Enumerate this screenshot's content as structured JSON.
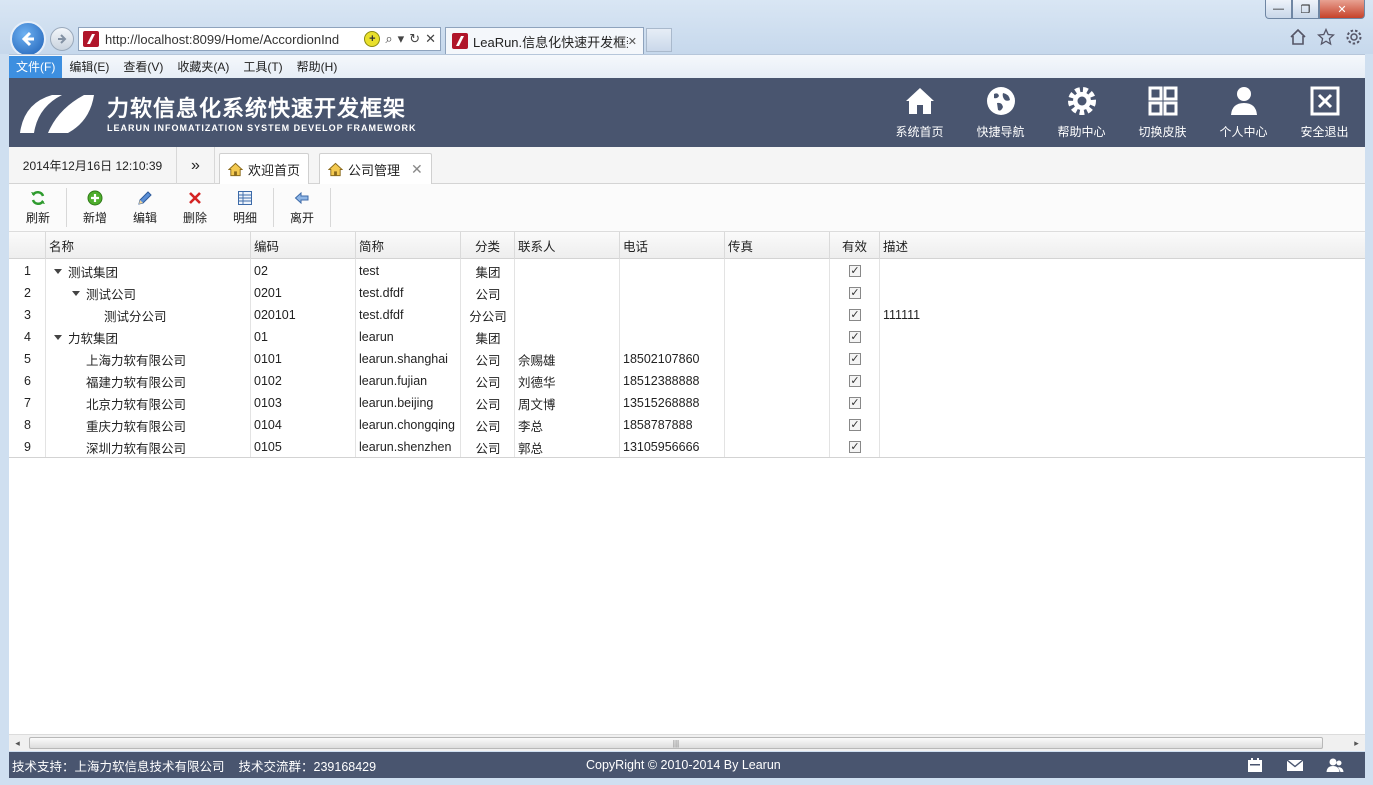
{
  "browser": {
    "url": "http://localhost:8099/Home/AccordionInd",
    "tab_title": "LeaRun.信息化快速开发框架",
    "compat_glyph": "+",
    "search_glyph": "⌕",
    "dropdown_glyph": "▾",
    "refresh_glyph": "↻",
    "close_glyph": "✕",
    "tab_close_glyph": "✕"
  },
  "window_controls": {
    "minimize": "—",
    "restore": "❐",
    "close": "✕"
  },
  "menu": [
    {
      "label": "文件(F)",
      "active": true
    },
    {
      "label": "编辑(E)"
    },
    {
      "label": "查看(V)"
    },
    {
      "label": "收藏夹(A)"
    },
    {
      "label": "工具(T)"
    },
    {
      "label": "帮助(H)"
    }
  ],
  "header": {
    "title": "力软信息化系统快速开发框架",
    "subtitle": "LEARUN INFOMATIZATION SYSTEM DEVELOP FRAMEWORK",
    "nav": [
      {
        "label": "系统首页",
        "icon": "home-icon"
      },
      {
        "label": "快捷导航",
        "icon": "globe-icon"
      },
      {
        "label": "帮助中心",
        "icon": "gear-icon"
      },
      {
        "label": "切换皮肤",
        "icon": "grid-icon"
      },
      {
        "label": "个人中心",
        "icon": "user-icon"
      },
      {
        "label": "安全退出",
        "icon": "exit-icon"
      }
    ]
  },
  "tabbar": {
    "datetime": "2014年12月16日 12:10:39",
    "collapse_glyph": "»",
    "tabs": [
      {
        "label": "欢迎首页"
      },
      {
        "label": "公司管理",
        "closable": true
      }
    ]
  },
  "toolbar": {
    "buttons": [
      {
        "label": "刷新",
        "icon": "refresh-icon"
      },
      {
        "label": "新增",
        "icon": "add-icon"
      },
      {
        "label": "编辑",
        "icon": "pencil-icon"
      },
      {
        "label": "删除",
        "icon": "delete-icon"
      },
      {
        "label": "明细",
        "icon": "detail-icon"
      },
      {
        "label": "离开",
        "icon": "leave-icon"
      }
    ]
  },
  "grid": {
    "columns": [
      "名称",
      "编码",
      "简称",
      "分类",
      "联系人",
      "电话",
      "传真",
      "有效",
      "描述"
    ],
    "rows": [
      {
        "num": "1",
        "name": "测试集团",
        "level": 0,
        "expanded": true,
        "code": "02",
        "short": "test",
        "type": "集团",
        "contact": "",
        "phone": "",
        "fax": "",
        "valid": true,
        "desc": ""
      },
      {
        "num": "2",
        "name": "测试公司",
        "level": 1,
        "expanded": true,
        "code": "0201",
        "short": "test.dfdf",
        "type": "公司",
        "contact": "",
        "phone": "",
        "fax": "",
        "valid": true,
        "desc": ""
      },
      {
        "num": "3",
        "name": "测试分公司",
        "level": 2,
        "expanded": false,
        "code": "020101",
        "short": "test.dfdf",
        "type": "分公司",
        "contact": "",
        "phone": "",
        "fax": "",
        "valid": true,
        "desc": "111111"
      },
      {
        "num": "4",
        "name": "力软集团",
        "level": 0,
        "expanded": true,
        "code": "01",
        "short": "learun",
        "type": "集团",
        "contact": "",
        "phone": "",
        "fax": "",
        "valid": true,
        "desc": ""
      },
      {
        "num": "5",
        "name": "上海力软有限公司",
        "level": 1,
        "expanded": false,
        "code": "0101",
        "short": "learun.shanghai",
        "type": "公司",
        "contact": "佘赐雄",
        "phone": "18502107860",
        "fax": "",
        "valid": true,
        "desc": ""
      },
      {
        "num": "6",
        "name": "福建力软有限公司",
        "level": 1,
        "expanded": false,
        "code": "0102",
        "short": "learun.fujian",
        "type": "公司",
        "contact": "刘德华",
        "phone": "18512388888",
        "fax": "",
        "valid": true,
        "desc": ""
      },
      {
        "num": "7",
        "name": "北京力软有限公司",
        "level": 1,
        "expanded": false,
        "code": "0103",
        "short": "learun.beijing",
        "type": "公司",
        "contact": "周文博",
        "phone": "13515268888",
        "fax": "",
        "valid": true,
        "desc": ""
      },
      {
        "num": "8",
        "name": "重庆力软有限公司",
        "level": 1,
        "expanded": false,
        "code": "0104",
        "short": "learun.chongqing",
        "type": "公司",
        "contact": "李总",
        "phone": "1858787888",
        "fax": "",
        "valid": true,
        "desc": ""
      },
      {
        "num": "9",
        "name": "深圳力软有限公司",
        "level": 1,
        "expanded": false,
        "code": "0105",
        "short": "learun.shenzhen",
        "type": "公司",
        "contact": "郭总",
        "phone": "13105956666",
        "fax": "",
        "valid": true,
        "desc": ""
      }
    ]
  },
  "scrollbar": {
    "left": "◂",
    "right": "▸",
    "grip": "|||"
  },
  "footer": {
    "support": "技术支持：上海力软信息技术有限公司",
    "group": "技术交流群：239168429",
    "copyright": "CopyRight © 2010-2014 By Learun"
  }
}
